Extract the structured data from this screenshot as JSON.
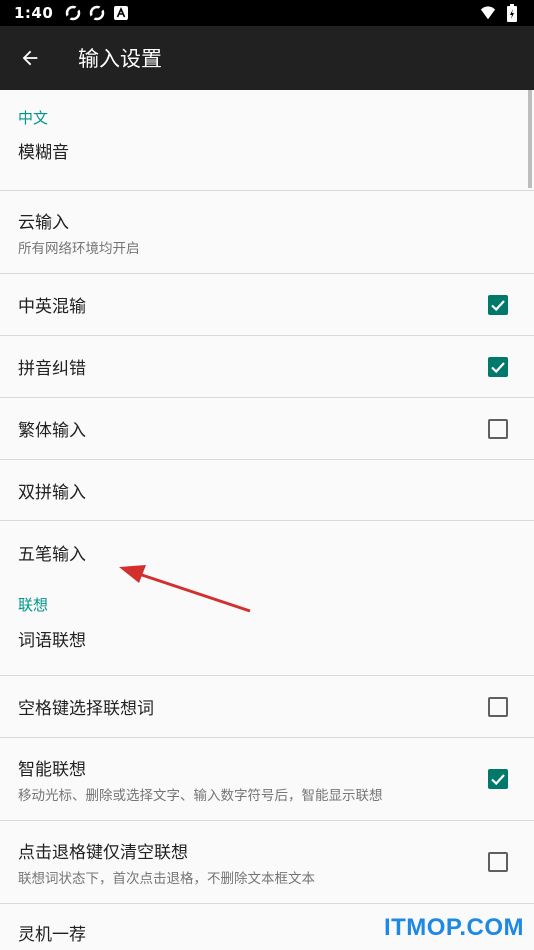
{
  "status_bar": {
    "time": "1:40",
    "icons": [
      "sync-icon",
      "sync-icon",
      "a-icon"
    ],
    "right_icons": [
      "wifi-icon",
      "battery-icon"
    ]
  },
  "app_bar": {
    "title": "输入设置"
  },
  "sections": [
    {
      "category": "中文",
      "items": [
        {
          "title": "模糊音"
        },
        {
          "title": "云输入",
          "summary": "所有网络环境均开启"
        },
        {
          "title": "中英混输",
          "checked": true
        },
        {
          "title": "拼音纠错",
          "checked": true
        },
        {
          "title": "繁体输入",
          "checked": false
        },
        {
          "title": "双拼输入"
        },
        {
          "title": "五笔输入"
        }
      ]
    },
    {
      "category": "联想",
      "items": [
        {
          "title": "词语联想"
        },
        {
          "title": "空格键选择联想词",
          "checked": false
        },
        {
          "title": "智能联想",
          "summary": "移动光标、删除或选择文字、输入数字符号后，智能显示联想",
          "checked": true
        },
        {
          "title": "点击退格键仅清空联想",
          "summary": "联想词状态下，首次点击退格，不删除文本框文本",
          "checked": false
        },
        {
          "title": "灵机一荐",
          "checked": true
        }
      ]
    }
  ],
  "watermark": "ITMOP.COM",
  "colors": {
    "accent": "#009688",
    "checkbox_on": "#00796b",
    "appbar": "#212121",
    "arrow": "#d32f2f"
  }
}
